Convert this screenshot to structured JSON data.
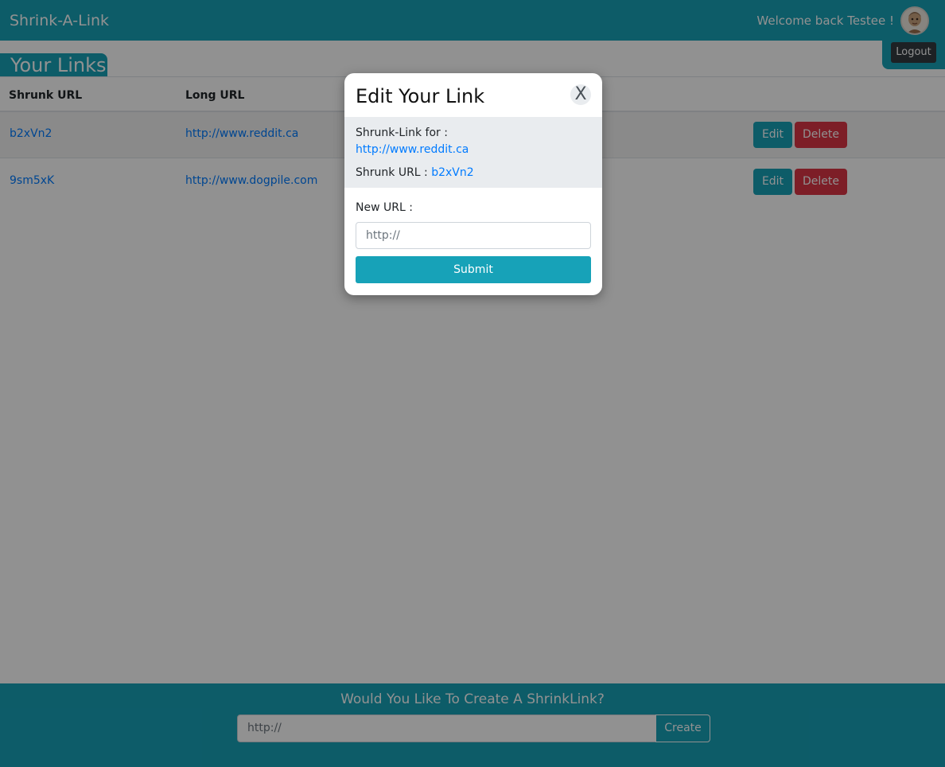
{
  "header": {
    "brand": "Shrink-A-Link",
    "welcome": "Welcome back Testee !",
    "logout_label": "Logout"
  },
  "main": {
    "title": "Your Links",
    "table": {
      "columns": [
        "Shrunk URL",
        "Long URL"
      ],
      "rows": [
        {
          "short": "b2xVn2",
          "long": "http://www.reddit.ca",
          "edit_label": "Edit",
          "delete_label": "Delete"
        },
        {
          "short": "9sm5xK",
          "long": "http://www.dogpile.com",
          "edit_label": "Edit",
          "delete_label": "Delete"
        }
      ]
    }
  },
  "modal": {
    "title": "Edit Your Link",
    "close_label": "X",
    "for_label": "Shrunk-Link for :",
    "long_url": "http://www.reddit.ca",
    "short_label": "Shrunk URL :",
    "short_url": "b2xVn2",
    "new_url_label": "New URL :",
    "new_url_placeholder": "http://",
    "submit_label": "Submit"
  },
  "footer": {
    "prompt": "Would You Like To Create A ShrinkLink?",
    "input_placeholder": "http://",
    "create_label": "Create"
  },
  "colors": {
    "primary": "#17a2b8",
    "danger": "#dc3545",
    "link": "#007bff",
    "dark": "#343a40"
  }
}
